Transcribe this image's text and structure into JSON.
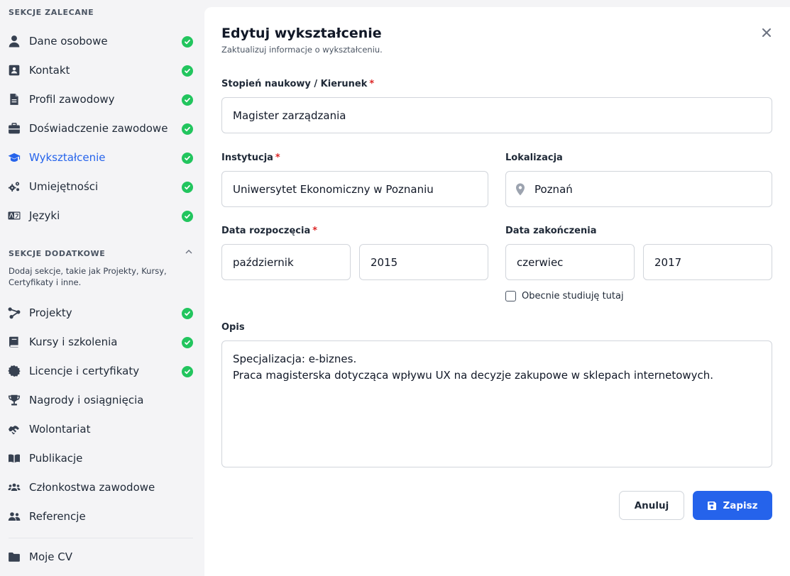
{
  "sidebar": {
    "recommended_title": "SEKCJE ZALECANE",
    "recommended": [
      {
        "label": "Dane osobowe",
        "icon": "user-icon"
      },
      {
        "label": "Kontakt",
        "icon": "contact-card-icon"
      },
      {
        "label": "Profil zawodowy",
        "icon": "document-icon"
      },
      {
        "label": "Doświadczenie zawodowe",
        "icon": "briefcase-icon"
      },
      {
        "label": "Wykształcenie",
        "icon": "graduation-cap-icon"
      },
      {
        "label": "Umiejętności",
        "icon": "gears-icon"
      },
      {
        "label": "Języki",
        "icon": "language-icon"
      }
    ],
    "extra_title": "SEKCJE DODATKOWE",
    "extra_desc": "Dodaj sekcje, takie jak Projekty, Kursy, Certyfikaty i inne.",
    "extra": [
      {
        "label": "Projekty",
        "icon": "project-diagram-icon"
      },
      {
        "label": "Kursy i szkolenia",
        "icon": "book-icon"
      },
      {
        "label": "Licencje i certyfikaty",
        "icon": "certificate-icon"
      },
      {
        "label": "Nagrody i osiągnięcia",
        "icon": "trophy-icon"
      },
      {
        "label": "Wolontariat",
        "icon": "handshake-icon"
      },
      {
        "label": "Publikacje",
        "icon": "open-book-icon"
      },
      {
        "label": "Członkostwa zawodowe",
        "icon": "users-icon"
      },
      {
        "label": "Referencje",
        "icon": "user-friends-icon"
      }
    ],
    "my_cv": {
      "label": "Moje CV",
      "icon": "folder-icon"
    }
  },
  "modal": {
    "title": "Edytuj wykształcenie",
    "subtitle": "Zaktualizuj informacje o wykształceniu.",
    "degree_label": "Stopień naukowy / Kierunek",
    "degree_value": "Magister zarządzania",
    "institution_label": "Instytucja",
    "institution_value": "Uniwersytet Ekonomiczny w Poznaniu",
    "location_label": "Lokalizacja",
    "location_value": "Poznań",
    "start_label": "Data rozpoczęcia",
    "start_month": "październik",
    "start_year": "2015",
    "end_label": "Data zakończenia",
    "end_month": "czerwiec",
    "end_year": "2017",
    "current_label": "Obecnie studiuję tutaj",
    "description_label": "Opis",
    "description_value": "Specjalizacja: e-biznes.\nPraca magisterska dotycząca wpływu UX na decyzje zakupowe w sklepach internetowych.",
    "required_mark": "*",
    "cancel_label": "Anuluj",
    "save_label": "Zapisz"
  },
  "colors": {
    "accent": "#2563eb",
    "success": "#22c55e",
    "required": "#dc2626"
  }
}
